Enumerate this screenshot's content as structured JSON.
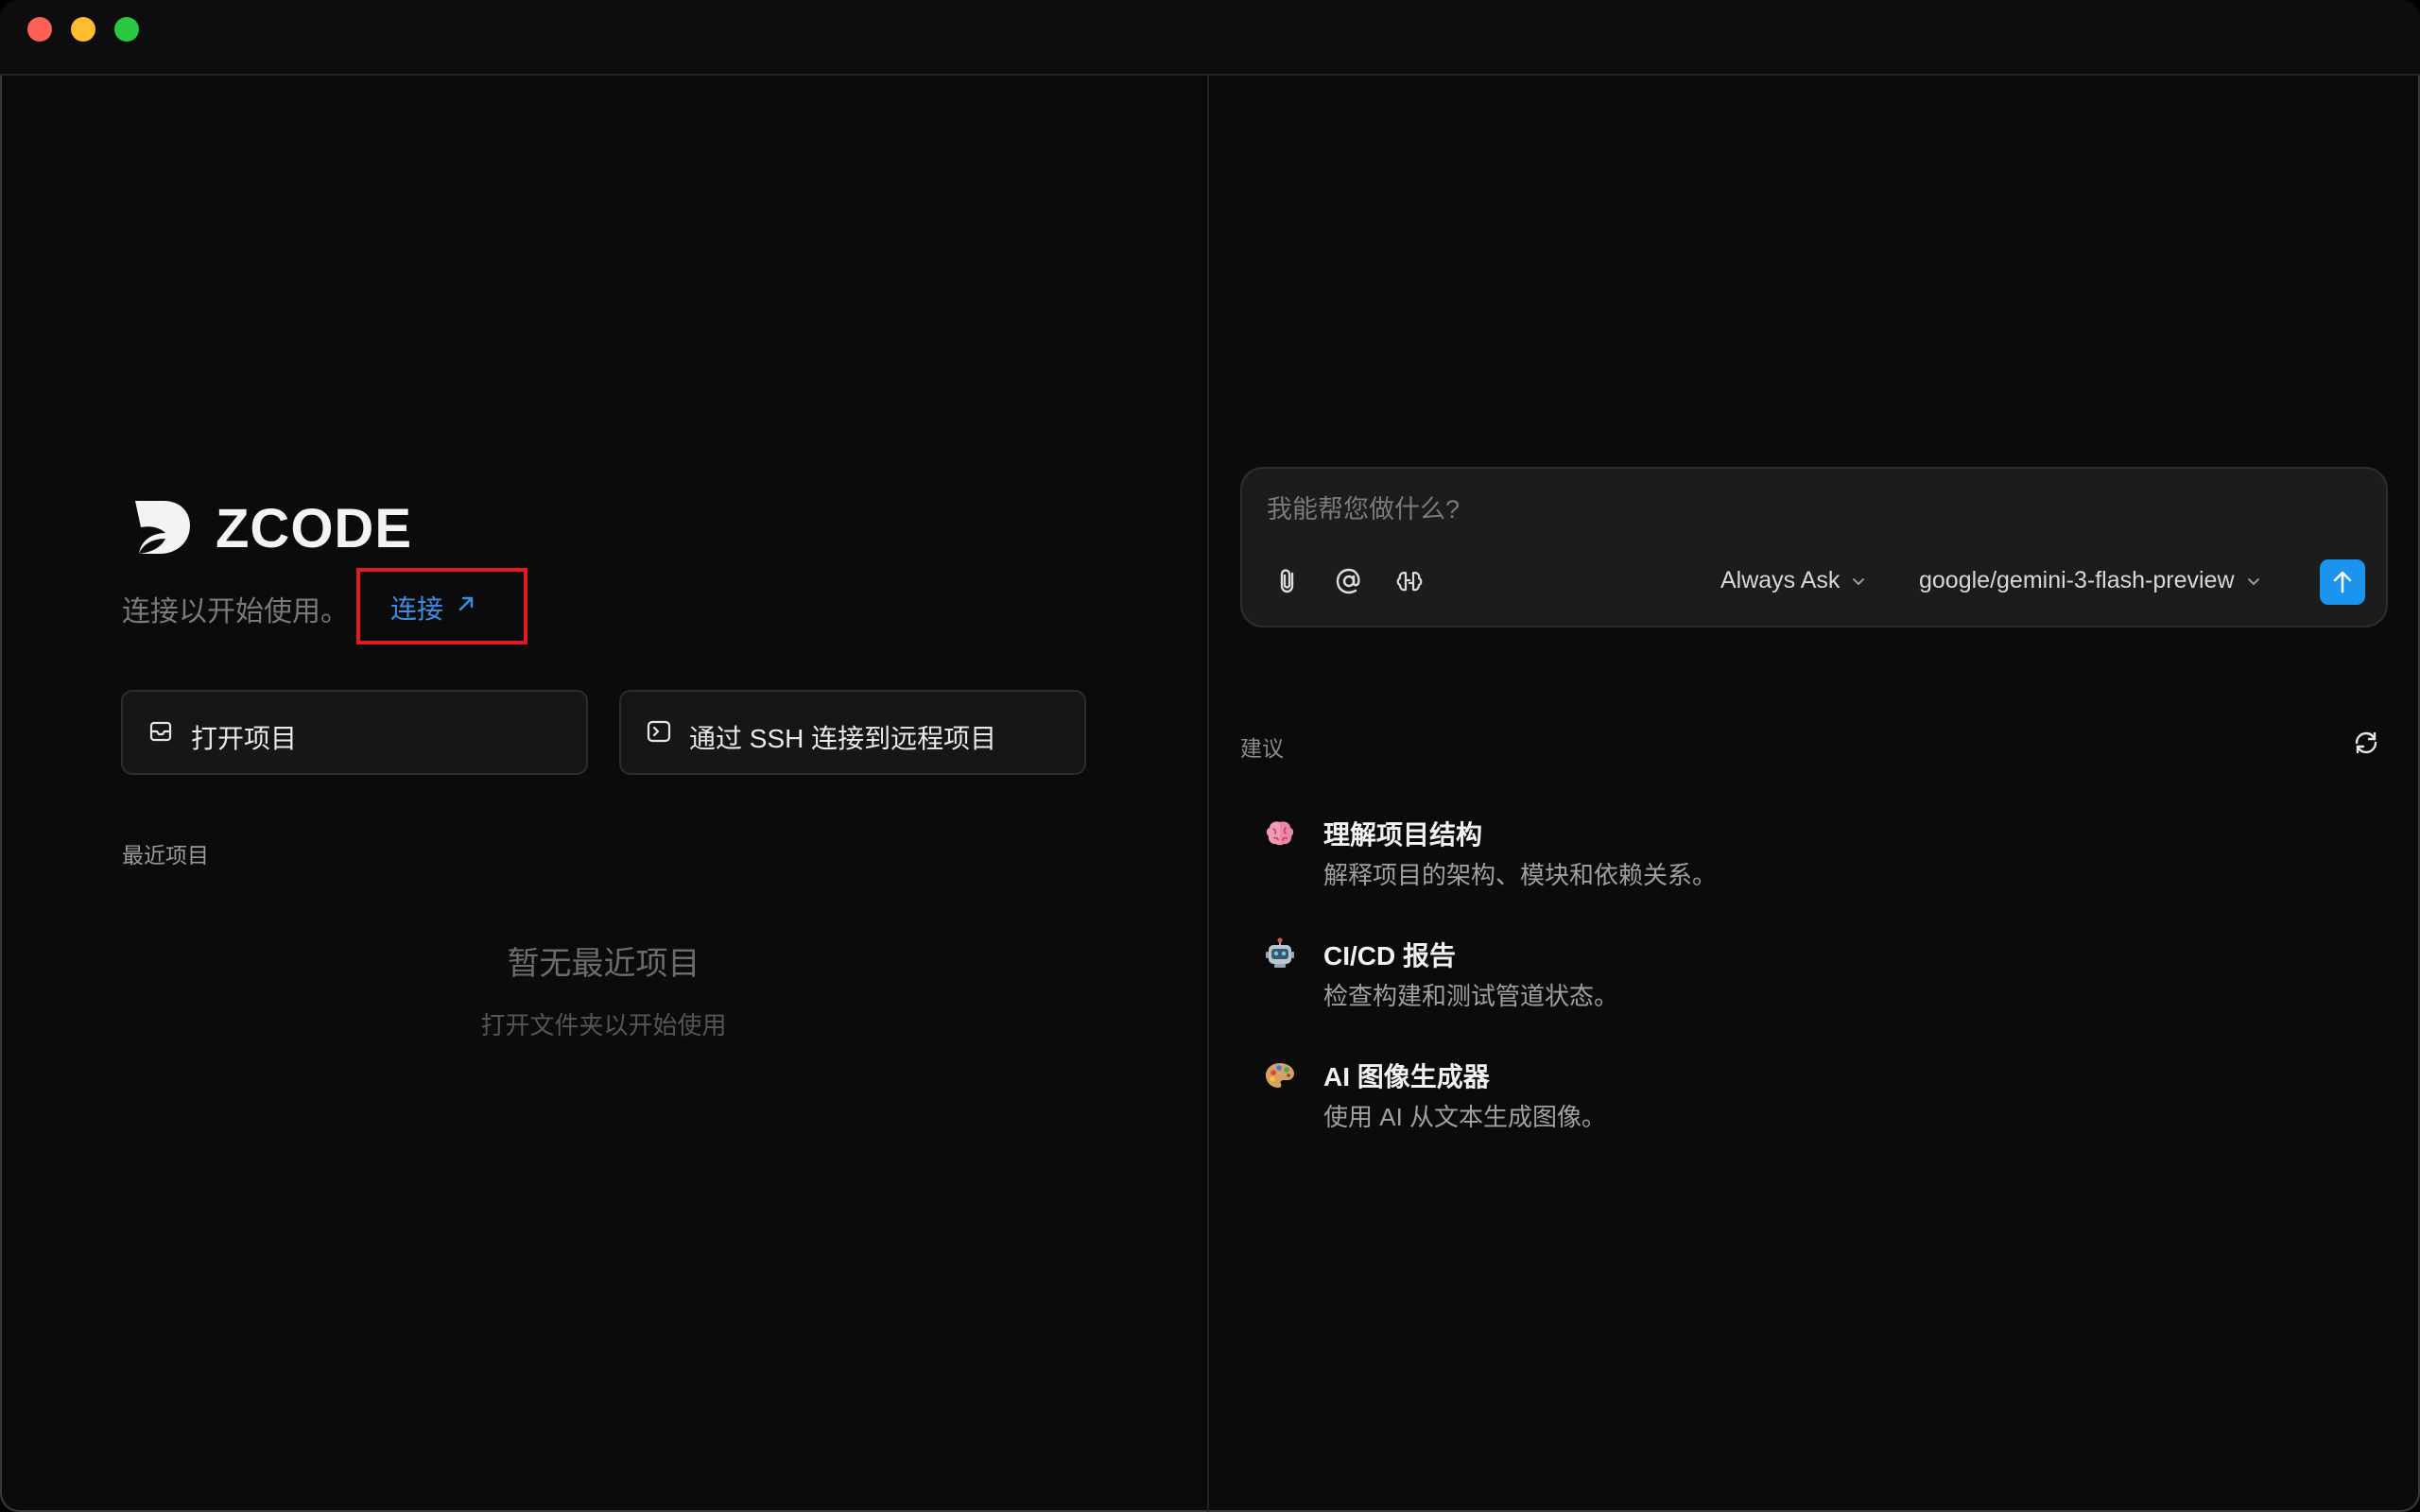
{
  "app": {
    "brand": "ZCODE",
    "connect_prompt": "连接以开始使用。",
    "connect_link": "连接"
  },
  "actions": {
    "open_project": "打开项目",
    "ssh_connect": "通过 SSH 连接到远程项目"
  },
  "recent": {
    "title": "最近项目",
    "empty_title": "暂无最近项目",
    "empty_subtitle": "打开文件夹以开始使用"
  },
  "chat": {
    "placeholder": "我能帮您做什么?",
    "mode": "Always Ask",
    "model": "google/gemini-3-flash-preview",
    "accent": "#1a94ee"
  },
  "suggestions": {
    "title": "建议",
    "items": [
      {
        "icon": "brain-icon",
        "title": "理解项目结构",
        "desc": "解释项目的架构、模块和依赖关系。"
      },
      {
        "icon": "robot-icon",
        "title": "CI/CD 报告",
        "desc": "检查构建和测试管道状态。"
      },
      {
        "icon": "palette-icon",
        "title": "AI 图像生成器",
        "desc": "使用 AI 从文本生成图像。"
      }
    ]
  }
}
